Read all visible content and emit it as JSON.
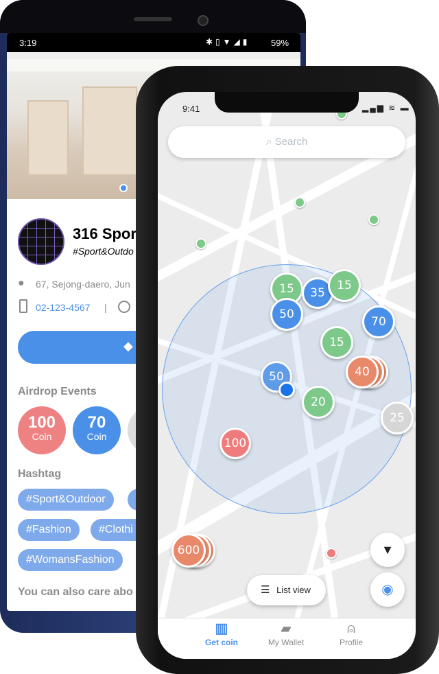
{
  "back_phone": {
    "status": {
      "time": "3:19",
      "battery": "59%"
    },
    "store": {
      "name": "316 Spor",
      "hashtag": "#Sport&Outdo",
      "address": "67, Sejong-daero, Jun",
      "phone": "02-123-4567",
      "separator": "|"
    },
    "airdrop_title": "Airdrop Events",
    "coins": [
      {
        "value": "100",
        "unit": "Coin",
        "color": "#ee8282"
      },
      {
        "value": "70",
        "unit": "Coin",
        "color": "#4a90e8"
      }
    ],
    "hashtag_title": "Hashtag",
    "hashtags": [
      "#Sport&Outdoor",
      "#Fashion",
      "#Clothi",
      "#WomansFashion"
    ],
    "more_title": "You can also care abo"
  },
  "front_phone": {
    "status": {
      "time": "9:41"
    },
    "search": {
      "placeholder": "Search"
    },
    "markers": [
      "15",
      "35",
      "15",
      "50",
      "70",
      "15",
      "40",
      "50",
      "20",
      "25",
      "100",
      "600"
    ],
    "list_view_label": "List view",
    "nav": [
      {
        "label": "Get coin",
        "icon": "map-icon",
        "active": true
      },
      {
        "label": "My Wallet",
        "icon": "wallet-icon"
      },
      {
        "label": "Profile",
        "icon": "person-icon"
      }
    ],
    "colors": {
      "accent": "#4a90e8",
      "green": "#7cc98a",
      "orange": "#e8896a",
      "red": "#ee7c7c",
      "gray": "#d6d6d6"
    }
  }
}
